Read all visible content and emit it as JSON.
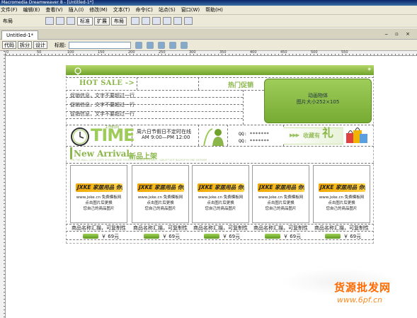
{
  "window": {
    "title": "Macromedia Dreamweaver 8 - [Untitled-1*]"
  },
  "menu": [
    "文件(F)",
    "编辑(E)",
    "查看(V)",
    "插入(I)",
    "修改(M)",
    "文本(T)",
    "命令(C)",
    "站点(S)",
    "窗口(W)",
    "帮助(H)"
  ],
  "insertbar": {
    "category": "布局",
    "buttons": [
      "标准",
      "扩展",
      "布局"
    ]
  },
  "document": {
    "tab": "Untitled-1*",
    "view_buttons": [
      "代码",
      "拆分",
      "设计"
    ],
    "title_label": "标题:",
    "title_value": ""
  },
  "ruler": {
    "marks": [
      "0",
      "50",
      "100",
      "150",
      "200",
      "250",
      "300",
      "350",
      "400",
      "450",
      "500",
      "550"
    ]
  },
  "design": {
    "hot_sale": "HOT SALE ->",
    "hot_promo": "热门促销",
    "promo_lines": [
      "促销信息，文字不要超过一行",
      "促销信息，文字不要超过一行",
      "促销信息，文字不要超过一行"
    ],
    "animation_box": {
      "line1": "动画物体",
      "line2": "图片大小252×105"
    },
    "time_label": "TIME",
    "time_sub": "工作时间",
    "hours_line1": "周六日节假日不定时在线",
    "hours_line2": "AM 9:00—PM 12:00",
    "qq": [
      "QQ: *******",
      "QQ: *******"
    ],
    "favorite_text": "收藏有",
    "favorite_char": "礼",
    "new_arrival": "New Arrival",
    "new_arrival_cn": "新品上架",
    "new_arrival_sub": "ON THE WALL, LOOK OVER SHOWER AND FOUNTAIN GRADE SHOWER - ADJUST NOT BACKUP IN ONE SHOWER",
    "products": [
      {
        "brand": "JXKE 家居用品 你我他",
        "lines": [
          "www.jxke.cn 免费模板网",
          "点击图片后更换",
          "您自己的商品图片"
        ],
        "name": "商品名称汇描，可复制性",
        "price": "￥ 69元"
      },
      {
        "brand": "JXKE 家居用品 你我他",
        "lines": [
          "www.jxke.cn 免费模板网",
          "点击图片后更换",
          "您自己的商品图片"
        ],
        "name": "商品名称汇描，可复制性",
        "price": "￥ 69元"
      },
      {
        "brand": "JXKE 家居用品 你我他",
        "lines": [
          "www.jxke.cn 免费模板网",
          "点击图片后更换",
          "您自己的商品图片"
        ],
        "name": "商品名称汇描，可复制性",
        "price": "￥ 69元"
      },
      {
        "brand": "JXKE 家居用品 你我他",
        "lines": [
          "www.jxke.cn 免费模板网",
          "点击图片后更换",
          "您自己的商品图片"
        ],
        "name": "商品名称汇描，可复制性",
        "price": "￥ 69元"
      },
      {
        "brand": "JXKE 家居用品 你我他",
        "lines": [
          "www.jxke.cn 免费模板网",
          "点击图片后更换",
          "您自己的商品图片"
        ],
        "name": "商品名称汇描，可复制性",
        "price": "￥ 69元"
      }
    ]
  },
  "watermark": {
    "line1": "货源批发网",
    "line2": "www.6pf.cn"
  },
  "colors": {
    "accent_green": "#8ab64a",
    "watermark_orange": "#ff6a00"
  }
}
